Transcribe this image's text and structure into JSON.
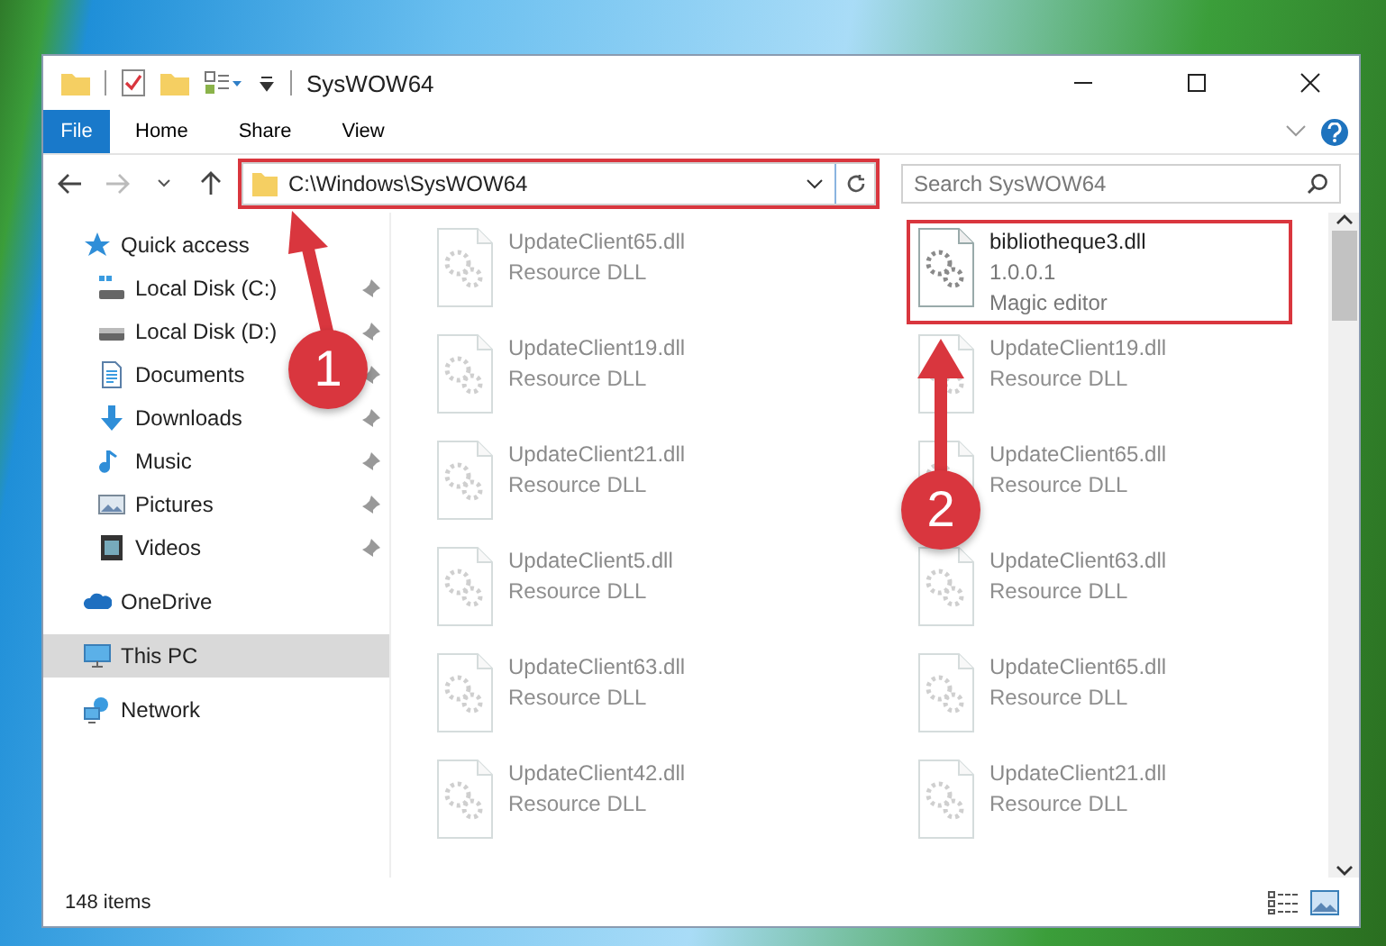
{
  "window": {
    "title": "SysWOW64"
  },
  "ribbon": {
    "file_button": "File",
    "tabs": [
      {
        "label": "Home",
        "selected": false
      },
      {
        "label": "Share",
        "selected": false
      },
      {
        "label": "View",
        "selected": false
      }
    ]
  },
  "address_bar": {
    "path": "C:\\Windows\\SysWOW64",
    "highlighted": true
  },
  "search": {
    "placeholder": "Search SysWOW64"
  },
  "navigation": [
    {
      "label": "Quick access",
      "selected": false,
      "children": [
        {
          "label": "Local Disk (C:)",
          "pinned": true,
          "selected": false
        },
        {
          "label": "Local Disk (D:)",
          "pinned": true,
          "selected": false
        },
        {
          "label": "Documents",
          "pinned": true,
          "selected": false
        },
        {
          "label": "Downloads",
          "pinned": true,
          "selected": false
        },
        {
          "label": "Music",
          "pinned": true,
          "selected": false
        },
        {
          "label": "Pictures",
          "pinned": true,
          "selected": false
        },
        {
          "label": "Videos",
          "pinned": true,
          "selected": false
        }
      ]
    },
    {
      "label": "OneDrive",
      "selected": false
    },
    {
      "label": "This PC",
      "selected": true
    },
    {
      "label": "Network",
      "selected": false
    }
  ],
  "files": [
    {
      "name": "UpdateClient65.dll",
      "details": [
        "Resource DLL"
      ],
      "dimmed": true,
      "highlighted": false
    },
    {
      "name": "bibliotheque3.dll",
      "details": [
        "1.0.0.1",
        "Magic editor"
      ],
      "dimmed": false,
      "highlighted": true
    },
    {
      "name": "UpdateClient19.dll",
      "details": [
        "Resource DLL"
      ],
      "dimmed": true,
      "highlighted": false
    },
    {
      "name": "UpdateClient19.dll",
      "details": [
        "Resource DLL"
      ],
      "dimmed": true,
      "highlighted": false
    },
    {
      "name": "UpdateClient21.dll",
      "details": [
        "Resource DLL"
      ],
      "dimmed": true,
      "highlighted": false
    },
    {
      "name": "UpdateClient65.dll",
      "details": [
        "Resource DLL"
      ],
      "dimmed": true,
      "highlighted": false
    },
    {
      "name": "UpdateClient5.dll",
      "details": [
        "Resource DLL"
      ],
      "dimmed": true,
      "highlighted": false
    },
    {
      "name": "UpdateClient63.dll",
      "details": [
        "Resource DLL"
      ],
      "dimmed": true,
      "highlighted": false
    },
    {
      "name": "UpdateClient63.dll",
      "details": [
        "Resource DLL"
      ],
      "dimmed": true,
      "highlighted": false
    },
    {
      "name": "UpdateClient65.dll",
      "details": [
        "Resource DLL"
      ],
      "dimmed": true,
      "highlighted": false
    },
    {
      "name": "UpdateClient42.dll",
      "details": [
        "Resource DLL"
      ],
      "dimmed": true,
      "highlighted": false
    },
    {
      "name": "UpdateClient21.dll",
      "details": [
        "Resource DLL"
      ],
      "dimmed": true,
      "highlighted": false
    }
  ],
  "status_bar": {
    "item_count": "148 items"
  },
  "annotations": [
    {
      "number": "1"
    },
    {
      "number": "2"
    }
  ]
}
